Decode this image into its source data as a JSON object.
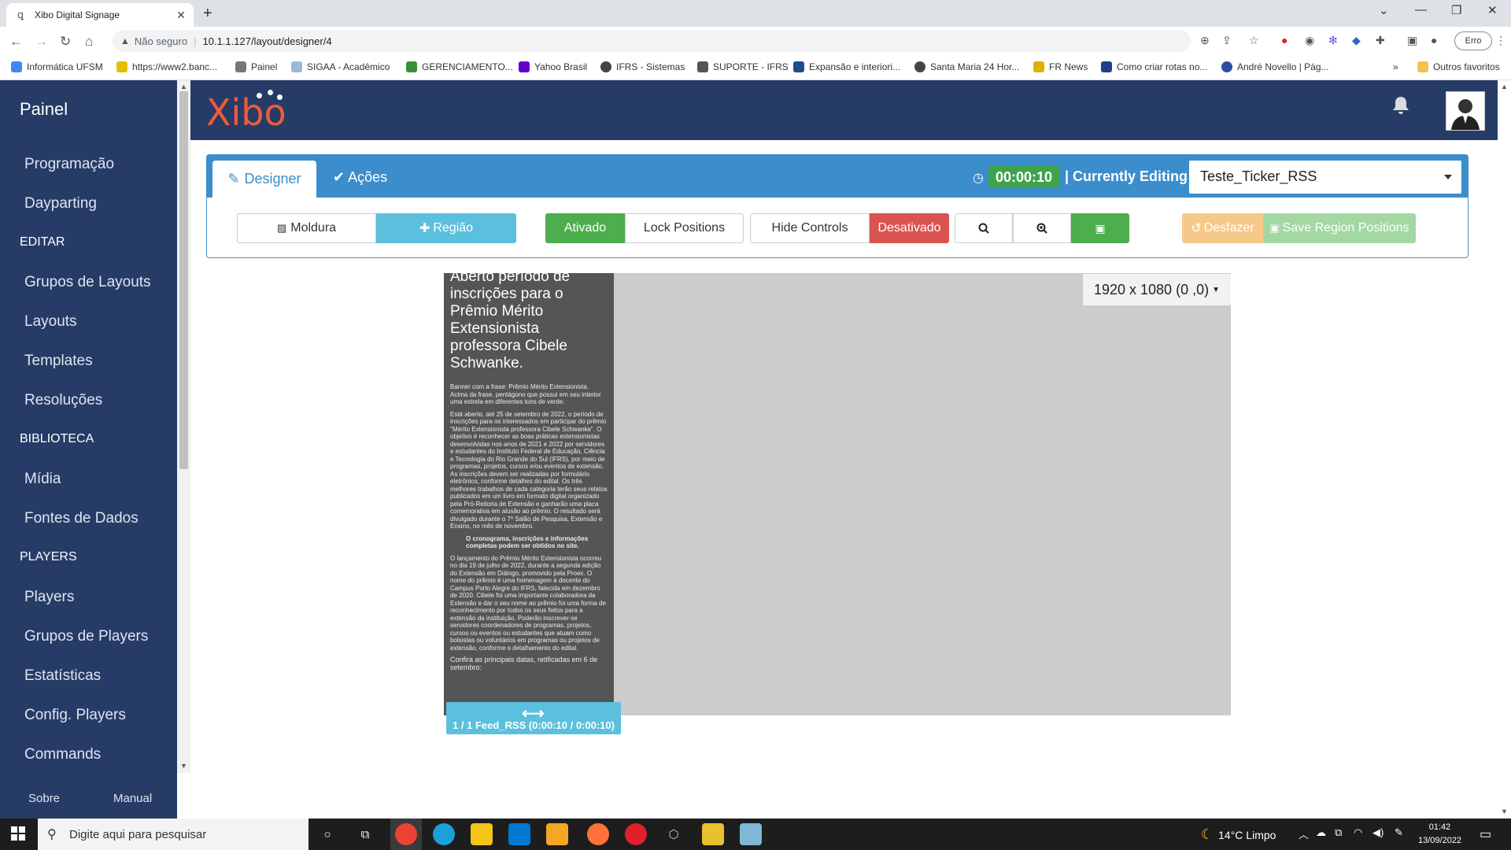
{
  "browser": {
    "tab_title": "Xibo Digital Signage",
    "insecure_label": "Não seguro",
    "url": "10.1.1.127/layout/designer/4",
    "error_pill": "Erro",
    "bookmarks": [
      "Informática UFSM",
      "https://www2.banc...",
      "Painel",
      "SIGAA - Acadêmico",
      "GERENCIAMENTO...",
      "Yahoo Brasil",
      "IFRS - Sistemas",
      "SUPORTE - IFRS",
      "Expansão e interiori...",
      "Santa Maria 24 Hor...",
      "FR News",
      "Como criar rotas no...",
      "André Novello | Pág..."
    ],
    "bookmarks_more": "»",
    "other_favorites": "Outros favoritos"
  },
  "sidebar": {
    "title": "Painel",
    "items": [
      "Programação",
      "Dayparting",
      "Grupos de Layouts",
      "Layouts",
      "Templates",
      "Resoluções",
      "Mídia",
      "Fontes de Dados",
      "Players",
      "Grupos de Players",
      "Estatísticas",
      "Config. Players",
      "Commands"
    ],
    "sections": [
      "EDITAR",
      "BIBLIOTECA",
      "PLAYERS"
    ],
    "footer": {
      "about": "Sobre",
      "manual": "Manual"
    }
  },
  "header": {
    "logo": "Xibo"
  },
  "designer": {
    "tab_designer": "Designer",
    "tab_actions": "Ações",
    "timer": "00:00:10",
    "currently_editing": "| Currently Editing",
    "layout_name": "Teste_Ticker_RSS",
    "buttons": {
      "moldura": "Moldura",
      "regiao": "Região",
      "ativado": "Ativado",
      "lock_positions": "Lock Positions",
      "hide_controls": "Hide Controls",
      "desativado": "Desativado",
      "desfazer": "Desfazer",
      "save_positions": "Save Region Positions"
    }
  },
  "viewer": {
    "resolution": "1920 x 1080 (0 ,0)",
    "region_label": "1 / 1 Feed_RSS (0:00:10 / 0:00:10)",
    "region_title": "Aberto período de inscrições para o Prêmio Mérito Extensionista professora Cibele Schwanke.",
    "region_paragraphs": [
      "Banner com a frase: Prêmio Mérito Extensionista. Acima da frase, pentágono que possui em seu interior uma estrela em diferentes tons de verde.",
      "Está aberto, até 25 de setembro de 2022, o período de inscrições para os interessados em participar do prêmio \"Mérito Extensionista professora Cibele Schwanke\". O objetivo é reconhecer as boas práticas extensionistas desenvolvidas nos anos de 2021 e 2022 por servidores e estudantes do Instituto Federal de Educação, Ciência e Tecnologia do Rio Grande do Sul (IFRS), por meio de programas, projetos, cursos e/ou eventos de extensão. As inscrições devem ser realizadas por formulário eletrônico, conforme detalhes do edital. Os três melhores trabalhos de cada categoria terão seus relatos publicados em um livro em formato digital organizado pela Pró-Reitoria de Extensão e ganharão uma placa comemorativa em alusão ao prêmio. O resultado será divulgado durante o 7º Salão de Pesquisa, Extensão e Ensino, no mês de novembro.",
      "O cronograma, inscrições e informações completas podem ser obtidos no site.",
      "O lançamento do Prêmio Mérito Extensionista ocorreu no dia 19 de julho de 2022, durante a segunda edição do Extensão em Diálogo, promovido pela Proex. O nome do prêmio é uma homenagem à docente do Campus Porto Alegre do IFRS, falecida em dezembro de 2020. Cibele foi uma importante colaboradora da Extensão e dar o seu nome ao prêmio foi uma forma de reconhecimento por todos os seus feitos para a extensão da instituição. Poderão inscrever-se servidores coordenadores de programas, projetos, cursos ou eventos ou estudantes que atuam como bolsistas ou voluntários em programas ou projetos de extensão, conforme o detalhamento do edital.",
      "Confira as principais datas, retificadas em 6 de setembro:"
    ]
  },
  "taskbar": {
    "search_placeholder": "Digite aqui para pesquisar",
    "weather": "14°C  Limpo",
    "time": "01:42",
    "date": "13/09/2022"
  },
  "colors": {
    "sidebar_bg": "#263b66",
    "primary": "#3c8dcb",
    "success": "#4cae4c",
    "danger": "#d9534f",
    "info": "#5bc0de",
    "logo": "#f05a3a"
  }
}
